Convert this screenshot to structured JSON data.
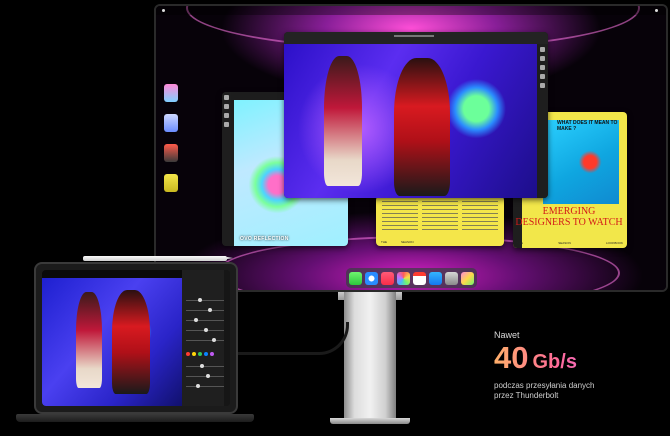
{
  "callout": {
    "prefix": "Nawet",
    "value": "40",
    "unit": "Gb/s",
    "description_line1": "podczas przesyłania danych",
    "description_line2": "przez Thunderbolt"
  },
  "display": {
    "editorial_window": {
      "eyebrow": "WHAT DOES IT MEAN TO MAKE ?",
      "headline": "EMERGING DESIGNERS TO WATCH",
      "footer": [
        "THE",
        "SEASON",
        "LOOKBOOK"
      ]
    },
    "comic_window": {
      "caption": "OVO REFLECTION"
    },
    "dock_icons": [
      "messages-icon",
      "safari-icon",
      "music-icon",
      "photos-icon",
      "calendar-icon",
      "app-store-icon",
      "settings-icon",
      "apps-folder-icon"
    ]
  },
  "colors": {
    "accent_gradient_start": "#ffb06a",
    "accent_gradient_mid": "#ff6a98",
    "accent_gradient_end": "#d86cff",
    "wallpaper_magenta": "#ff4fd8"
  }
}
